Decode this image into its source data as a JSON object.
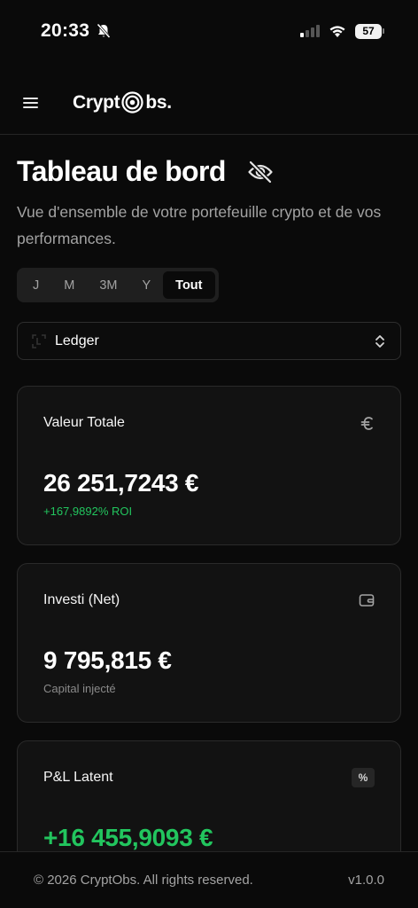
{
  "status_bar": {
    "time": "20:33",
    "battery": "57"
  },
  "header": {
    "logo_left": "Crypt",
    "logo_right": "bs."
  },
  "page": {
    "title": "Tableau de bord",
    "subtitle": "Vue d'ensemble de votre portefeuille crypto et de vos performances."
  },
  "period_tabs": [
    {
      "label": "J",
      "active": false
    },
    {
      "label": "M",
      "active": false
    },
    {
      "label": "3M",
      "active": false
    },
    {
      "label": "Y",
      "active": false
    },
    {
      "label": "Tout",
      "active": true
    }
  ],
  "wallet_select": {
    "selected": "Ledger"
  },
  "cards": {
    "total_value": {
      "title": "Valeur Totale",
      "value": "26 251,7243 €",
      "sub": "+167,9892% ROI",
      "icon": "euro-icon"
    },
    "invested": {
      "title": "Investi (Net)",
      "value": "9 795,815 €",
      "sub": "Capital injecté",
      "icon": "wallet-icon"
    },
    "pnl": {
      "title": "P&L Latent",
      "value": "+16 455,9093 €",
      "badge": "%"
    }
  },
  "footer": {
    "copyright": "© 2026 CryptObs. All rights reserved.",
    "version": "v1.0.0"
  },
  "colors": {
    "background": "#0a0a0a",
    "positive": "#22c55e",
    "muted": "#a3a3a3"
  }
}
